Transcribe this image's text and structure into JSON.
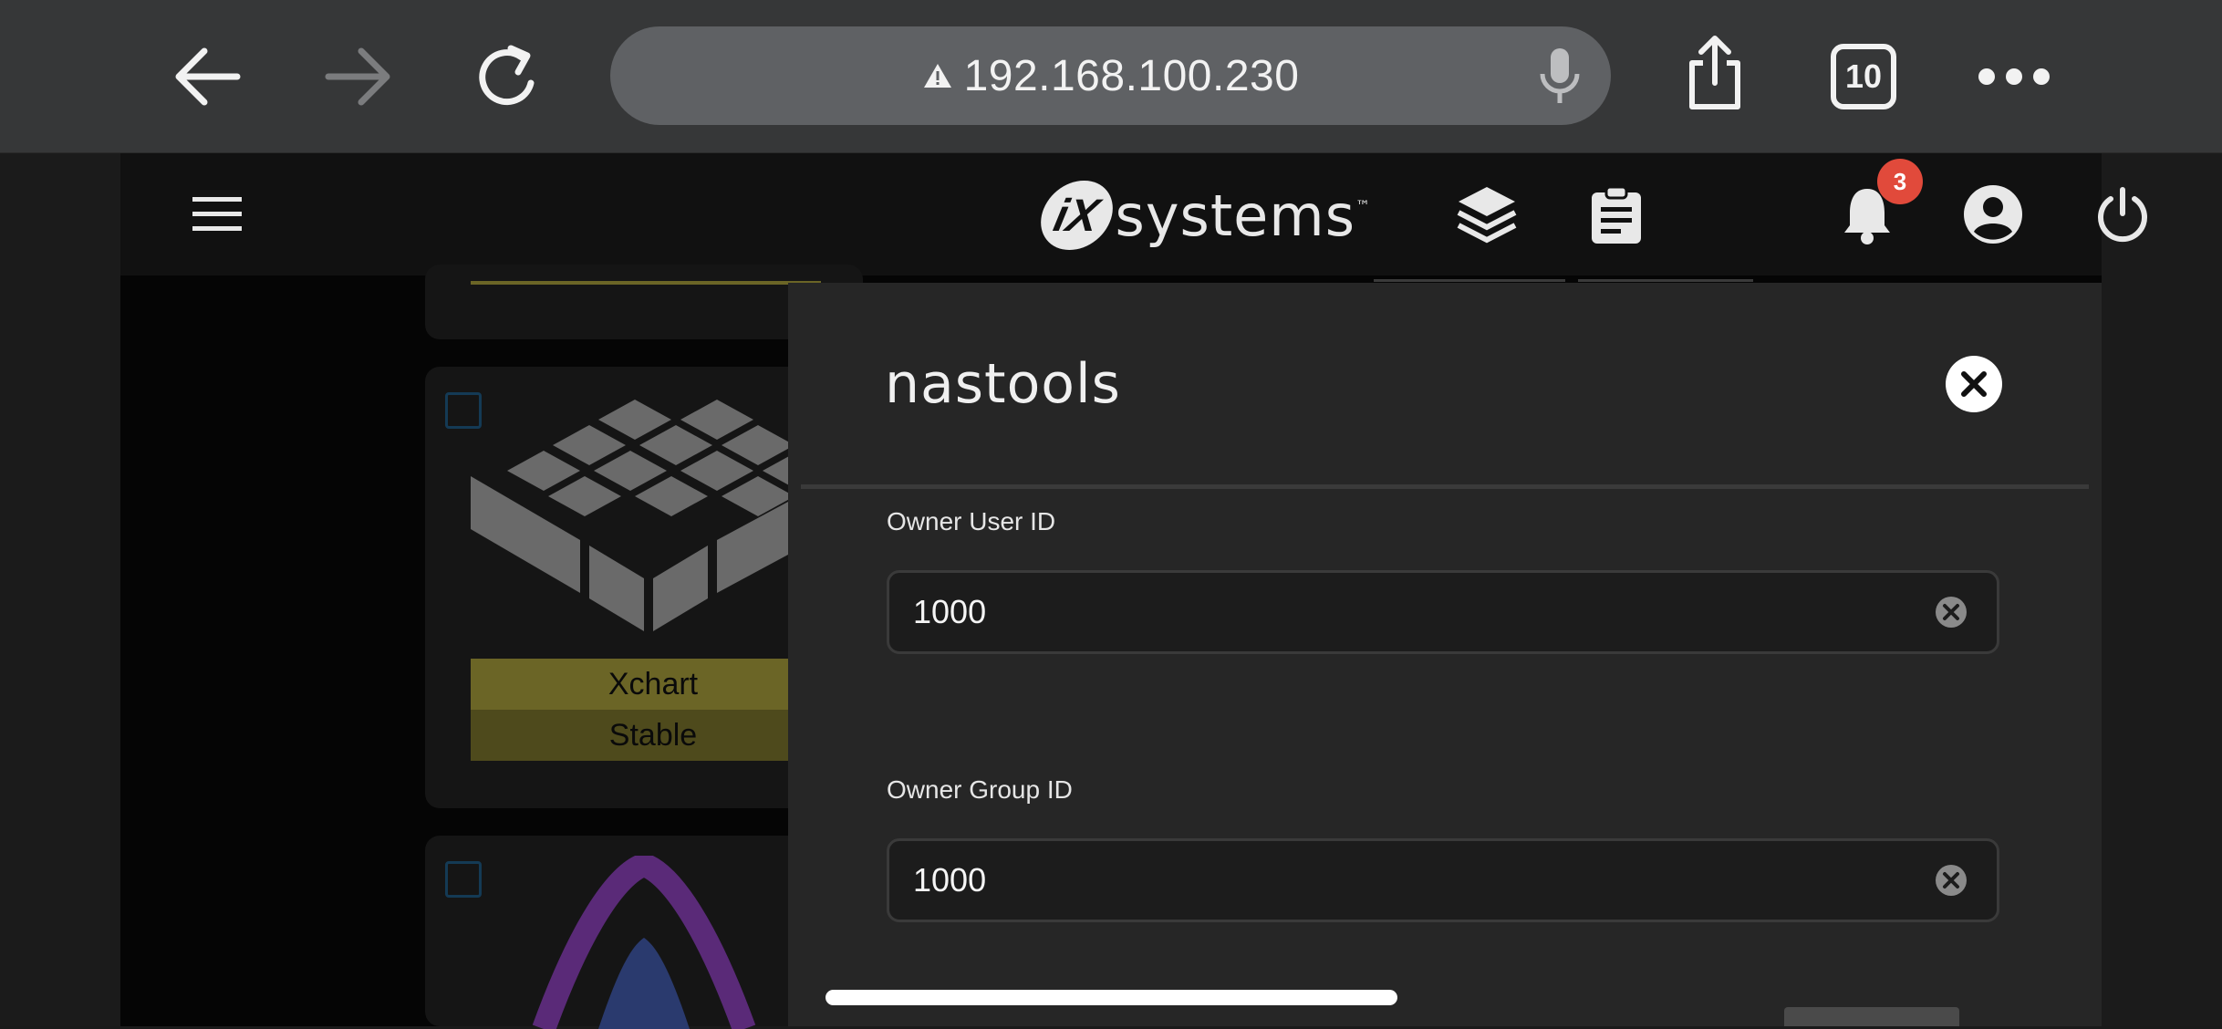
{
  "browser": {
    "url": "192.168.100.230",
    "tab_count": "10",
    "security_icon": "warning-triangle-icon"
  },
  "header": {
    "logo_mark": "iX",
    "logo_text": "systems",
    "logo_tm": "™",
    "notification_count": "3"
  },
  "background_cards": [
    {
      "title": "Xchart",
      "train": "Stable"
    }
  ],
  "dialog": {
    "title": "nastools",
    "fields": [
      {
        "label": "Owner User ID",
        "value": "1000"
      },
      {
        "label": "Owner Group ID",
        "value": "1000"
      }
    ]
  },
  "colors": {
    "accent_yellow": "#6b6526",
    "badge_red": "#e14a3b",
    "panel_bg": "#262626"
  }
}
